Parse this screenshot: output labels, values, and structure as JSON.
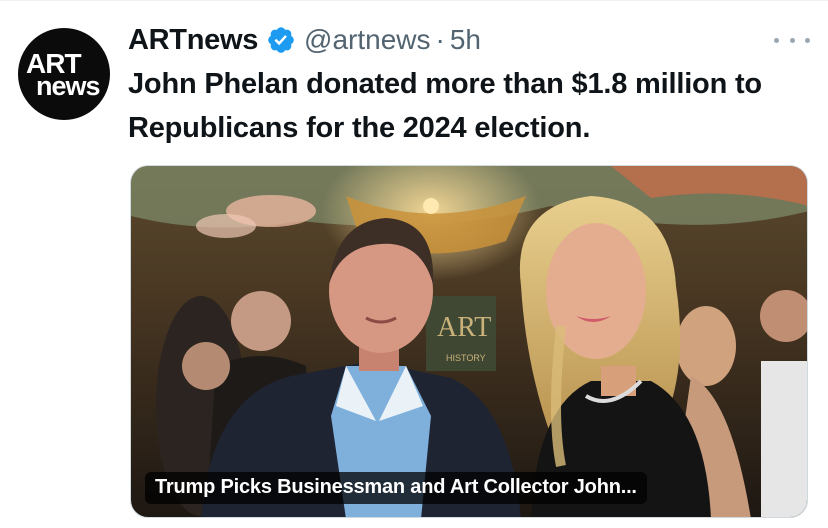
{
  "author": {
    "avatar_line1": "ART",
    "avatar_line2": "news",
    "display_name": "ARTnews",
    "handle": "@artnews",
    "separator": "·",
    "time": "5h"
  },
  "tweet": {
    "text": "John Phelan donated more than $1.8 million to Republicans for the 2024 election."
  },
  "media": {
    "card_title": "Trump Picks Businessman and Art Collector John...",
    "background_sign": "ART",
    "background_sign_sub": "HISTORY"
  },
  "icons": {
    "verified": "verified-badge-icon",
    "more": "more-options-icon"
  },
  "colors": {
    "text_primary": "#0f1419",
    "text_secondary": "#536471",
    "verified_blue": "#1d9bf0",
    "avatar_bg": "#0b0b0b"
  }
}
